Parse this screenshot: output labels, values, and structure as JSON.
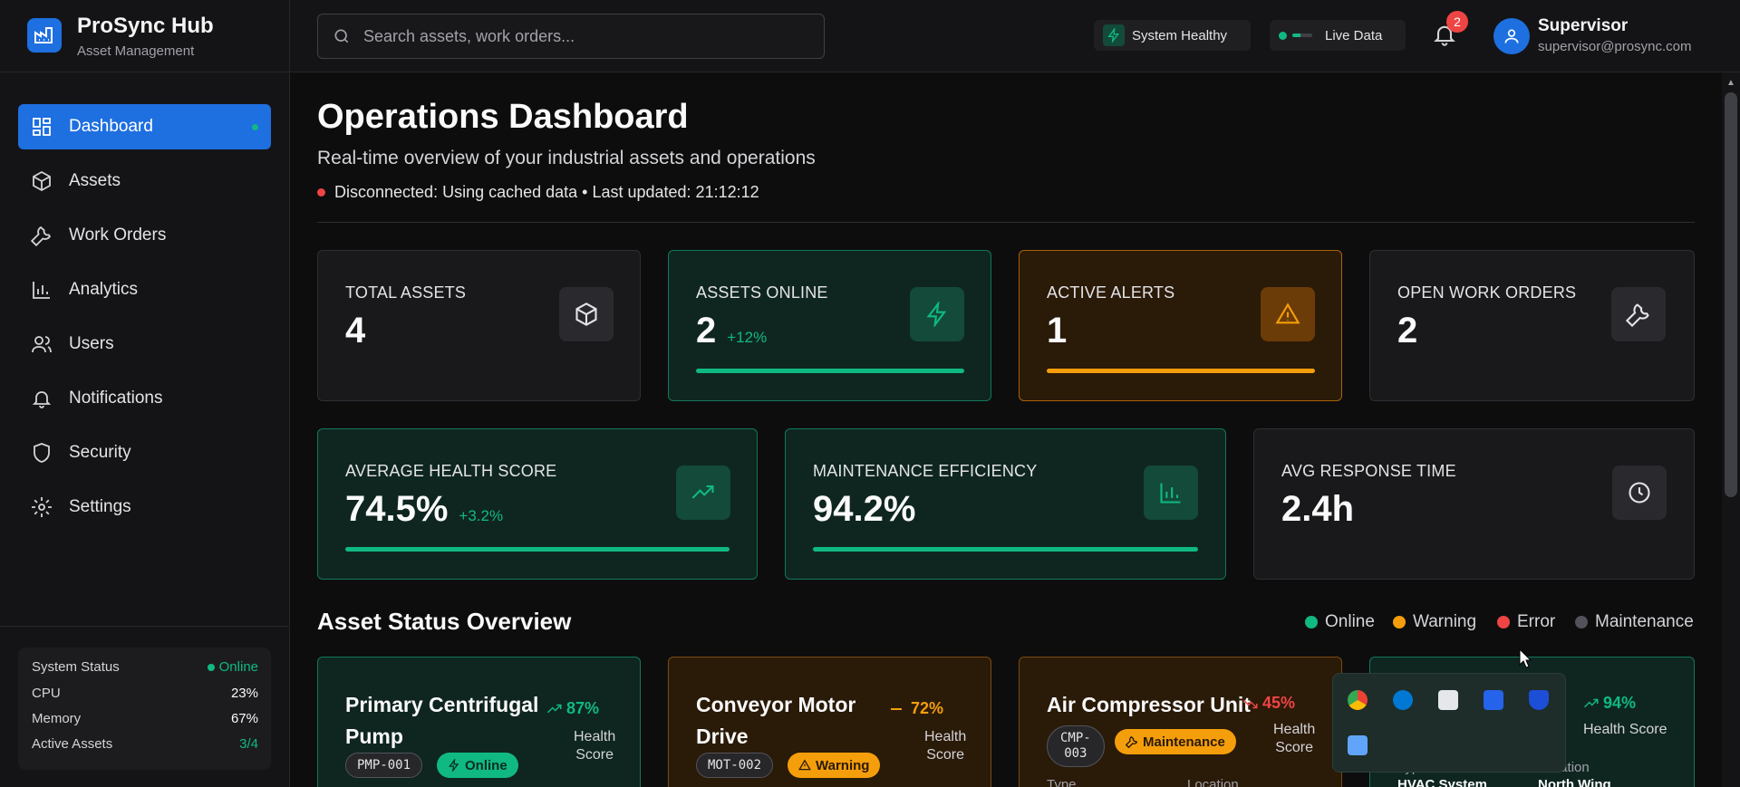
{
  "brand": {
    "name": "ProSync Hub",
    "subtitle": "Asset Management"
  },
  "search": {
    "placeholder": "Search assets, work orders..."
  },
  "header": {
    "system_status": "System Healthy",
    "live_label": "Live Data",
    "notification_count": "2",
    "user": {
      "name": "Supervisor",
      "email": "supervisor@prosync.com"
    }
  },
  "sidebar": {
    "items": [
      {
        "label": "Dashboard",
        "icon": "dashboard-icon",
        "active": true
      },
      {
        "label": "Assets",
        "icon": "box-icon"
      },
      {
        "label": "Work Orders",
        "icon": "wrench-icon"
      },
      {
        "label": "Analytics",
        "icon": "bar-chart-icon"
      },
      {
        "label": "Users",
        "icon": "users-icon"
      },
      {
        "label": "Notifications",
        "icon": "bell-icon"
      },
      {
        "label": "Security",
        "icon": "shield-icon"
      },
      {
        "label": "Settings",
        "icon": "gear-icon"
      }
    ],
    "system": {
      "title": "System Status",
      "status": "Online",
      "rows": [
        {
          "label": "CPU",
          "value": "23%"
        },
        {
          "label": "Memory",
          "value": "67%"
        },
        {
          "label": "Active Assets",
          "value": "3/4"
        }
      ]
    }
  },
  "main": {
    "title": "Operations Dashboard",
    "subtitle": "Real-time overview of your industrial assets and operations",
    "connection": "Disconnected: Using cached data • Last updated: 21:12:12",
    "kpis": [
      {
        "label": "TOTAL ASSETS",
        "value": "4",
        "delta": "",
        "icon": "box-icon",
        "variant": "default"
      },
      {
        "label": "ASSETS ONLINE",
        "value": "2",
        "delta": "+12%",
        "icon": "lightning-icon",
        "variant": "green",
        "progress": 1.0
      },
      {
        "label": "ACTIVE ALERTS",
        "value": "1",
        "delta": "",
        "icon": "warning-icon",
        "variant": "orange",
        "progress": 1.0
      },
      {
        "label": "OPEN WORK ORDERS",
        "value": "2",
        "delta": "",
        "icon": "wrench-icon",
        "variant": "default"
      }
    ],
    "kpis2": [
      {
        "label": "AVERAGE HEALTH SCORE",
        "value": "74.5%",
        "delta": "+3.2%",
        "icon": "trending-up-icon",
        "variant": "green",
        "progress": 1.0
      },
      {
        "label": "MAINTENANCE EFFICIENCY",
        "value": "94.2%",
        "delta": "",
        "icon": "bar-chart-icon",
        "variant": "green",
        "progress": 1.0
      },
      {
        "label": "AVG RESPONSE TIME",
        "value": "2.4h",
        "delta": "",
        "icon": "clock-icon",
        "variant": "default"
      }
    ],
    "section_title": "Asset Status Overview",
    "legend": [
      {
        "label": "Online",
        "color": "#10b981"
      },
      {
        "label": "Warning",
        "color": "#f59e0b"
      },
      {
        "label": "Error",
        "color": "#ef4444"
      },
      {
        "label": "Maintenance",
        "color": "#52525b"
      }
    ],
    "assets": [
      {
        "name_line1": "Primary Centrifugal",
        "name_line2": "Pump",
        "id": "PMP-001",
        "status": "Online",
        "score": "87%",
        "score_label_1": "Health",
        "score_label_2": "Score"
      },
      {
        "name_line1": "Conveyor Motor",
        "name_line2": "Drive",
        "id": "MOT-002",
        "status": "Warning",
        "score": "72%",
        "score_label_1": "Health",
        "score_label_2": "Score"
      },
      {
        "name_line1": "Air Compressor Unit",
        "name_line2": "",
        "id_line1": "CMP-",
        "id_line2": "003",
        "status": "Maintenance",
        "score": "45%",
        "score_label_1": "Health",
        "score_label_2": "Score",
        "meta_type": "Type",
        "meta_location": "Location"
      },
      {
        "score": "94%",
        "score_label": "Health Score",
        "meta_type": "Type",
        "meta_location": "Location",
        "type_value": "HVAC System",
        "location_value": "North Wing"
      }
    ]
  }
}
